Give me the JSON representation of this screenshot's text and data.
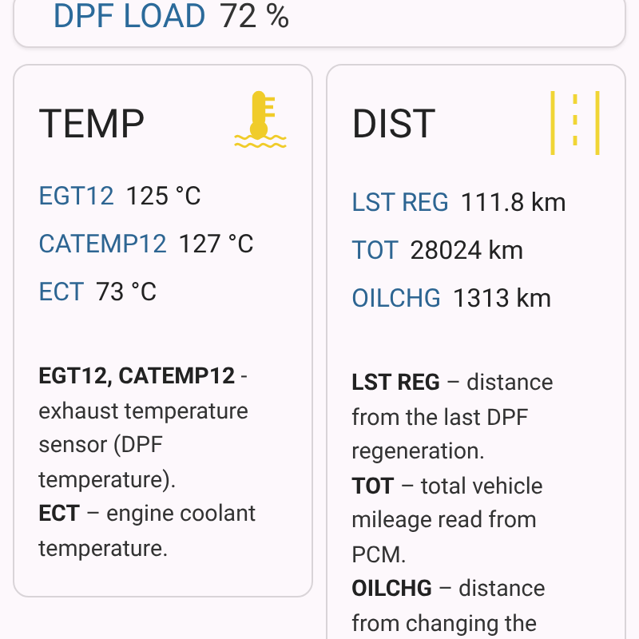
{
  "top_card": {
    "label": "DPF LOAD",
    "value": "72 %"
  },
  "cards": [
    {
      "kind": "temp",
      "title": "TEMP",
      "readings": [
        {
          "label": "EGT12",
          "value": "125 °C"
        },
        {
          "label": "CATEMP12",
          "value": "127 °C"
        },
        {
          "label": "ECT",
          "value": "73 °C"
        }
      ],
      "notes": [
        "**EGT12, CATEMP12** - exhaust temperature sensor (DPF temperature).",
        "**ECT** – engine coolant temperature."
      ]
    },
    {
      "kind": "dist",
      "title": "DIST",
      "readings": [
        {
          "label": "LST REG",
          "value": "111.8 km"
        },
        {
          "label": "TOT",
          "value": "28024 km"
        },
        {
          "label": "OILCHG",
          "value": "1313 km"
        }
      ],
      "notes": [
        "**LST REG** – distance from the last DPF regeneration.",
        "**TOT** – total vehicle mileage read from PCM.",
        "**OILCHG** – distance from changing the"
      ]
    }
  ]
}
